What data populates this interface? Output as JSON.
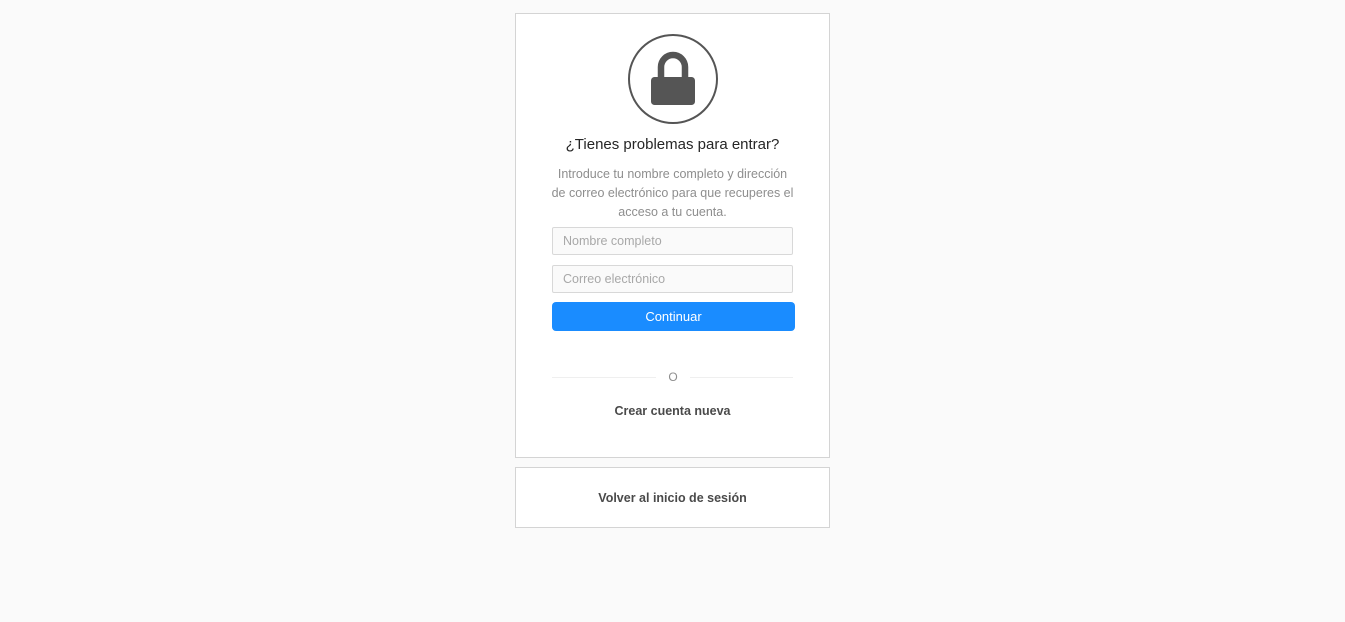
{
  "reset": {
    "icon": "lock-icon",
    "title": "¿Tienes problemas para entrar?",
    "description": "Introduce tu nombre completo y dirección de correo electrónico para que recuperes el acceso a tu cuenta.",
    "fullname_placeholder": "Nombre completo",
    "fullname_value": "",
    "email_placeholder": "Correo electrónico",
    "email_value": "",
    "continue_label": "Continuar",
    "divider_text": "O",
    "create_account_label": "Crear cuenta nueva"
  },
  "footer": {
    "back_to_login_label": "Volver al inicio de sesión"
  },
  "colors": {
    "background": "#fafafa",
    "accent": "#1a8cff",
    "icon": "#555555",
    "muted_text": "#8e8e8e"
  }
}
